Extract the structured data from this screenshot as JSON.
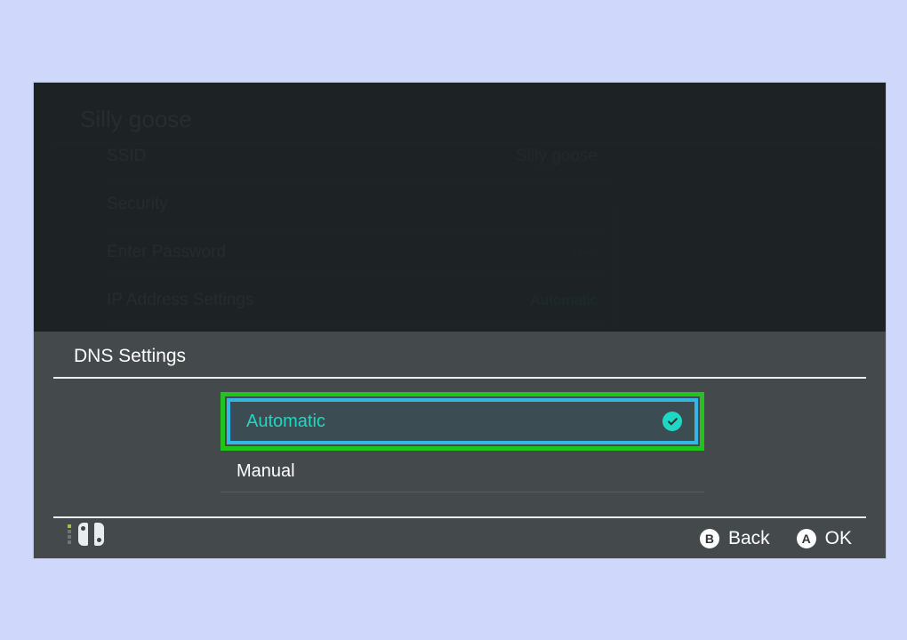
{
  "header": {
    "network_name": "Silly goose"
  },
  "rows": {
    "ssid": {
      "label": "SSID",
      "value": "Silly goose"
    },
    "sec": {
      "label": "Security",
      "value": ""
    },
    "pw": {
      "label": "Enter Password",
      "value": "·····"
    },
    "ip": {
      "label": "IP Address Settings",
      "value": "Automatic"
    },
    "dns": {
      "label": "DNS Settings",
      "value": "Automatic"
    }
  },
  "modal": {
    "title": "DNS Settings",
    "options": {
      "auto": "Automatic",
      "manual": "Manual"
    }
  },
  "footer": {
    "back": {
      "icon": "B",
      "label": "Back"
    },
    "ok": {
      "icon": "A",
      "label": "OK"
    }
  }
}
